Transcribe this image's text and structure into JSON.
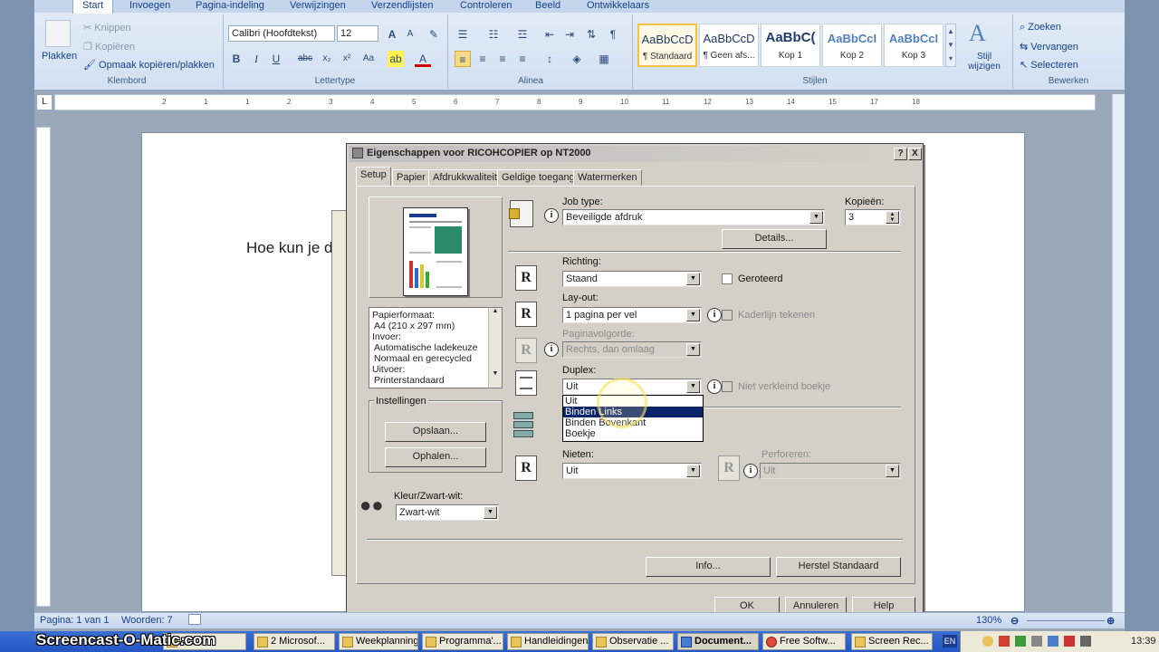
{
  "ribbon": {
    "tabs": [
      "Start",
      "Invoegen",
      "Pagina-indeling",
      "Verwijzingen",
      "Verzendlijsten",
      "Controleren",
      "Beeld",
      "Ontwikkelaars"
    ],
    "clipboard": {
      "paste": "Plakken",
      "cut": "Knippen",
      "copy": "Kopiëren",
      "format_painter": "Opmaak kopiëren/plakken",
      "label": "Klembord"
    },
    "font": {
      "name": "Calibri (Hoofdtekst)",
      "size": "12",
      "label": "Lettertype"
    },
    "paragraph": {
      "label": "Alinea"
    },
    "styles": {
      "items": [
        {
          "preview": "AaBbCcD",
          "name": "¶ Standaard"
        },
        {
          "preview": "AaBbCcD",
          "name": "¶ Geen afs..."
        },
        {
          "preview": "AaBbC(",
          "name": "Kop 1"
        },
        {
          "preview": "AaBbCcI",
          "name": "Kop 2"
        },
        {
          "preview": "AaBbCcI",
          "name": "Kop 3"
        }
      ],
      "change_styles": "Stijl wijzigen",
      "label": "Stijlen"
    },
    "editing": {
      "find": "Zoeken",
      "replace": "Vervangen",
      "select": "Selecteren",
      "label": "Bewerken"
    }
  },
  "ruler": {
    "marks": [
      "2",
      "1",
      "1",
      "2",
      "3",
      "4",
      "5",
      "6",
      "7",
      "8",
      "9",
      "10",
      "11",
      "12",
      "13",
      "14",
      "15",
      "17",
      "18"
    ]
  },
  "document": {
    "text": "Hoe kun je d"
  },
  "dialog": {
    "title": "Eigenschappen voor RICOHCOPIER op NT2000",
    "help_btn": "?",
    "close_btn": "X",
    "tabs": [
      "Setup",
      "Papier",
      "Afdrukkwaliteit",
      "Geldige toegang",
      "Watermerken"
    ],
    "paper_info": [
      "Papierformaat:",
      "A4 (210 x 297 mm)",
      "Invoer:",
      "Automatische ladekeuze",
      "Normaal en gerecycled",
      "Uitvoer:",
      "Printerstandaard"
    ],
    "settings_group": "Instellingen",
    "save_btn": "Opslaan...",
    "load_btn": "Ophalen...",
    "color_label": "Kleur/Zwart-wit:",
    "color_value": "Zwart-wit",
    "job_type_label": "Job type:",
    "job_type_value": "Beveiligde afdruk",
    "copies_label": "Kopieën:",
    "copies_value": "3",
    "details_btn": "Details...",
    "orientation_label": "Richting:",
    "orientation_value": "Staand",
    "rotated_label": "Geroteerd",
    "layout_label": "Lay-out:",
    "layout_value": "1 pagina per vel",
    "frame_label": "Kaderlijn tekenen",
    "page_order_label": "Paginavolgorde:",
    "page_order_value": "Rechts, dan omlaag",
    "duplex_label": "Duplex:",
    "duplex_value": "Uit",
    "booklet_label": "Niet verkleind boekje",
    "duplex_options": [
      "Uit",
      "Binden Links",
      "Binden Bovenkant",
      "Boekje"
    ],
    "staple_label": "Nieten:",
    "staple_value": "Uit",
    "punch_label": "Perforeren:",
    "punch_value": "Uit",
    "info_btn": "Info...",
    "restore_btn": "Herstel Standaard",
    "ok_btn": "OK",
    "cancel_btn": "Annuleren",
    "help_button": "Help"
  },
  "status": {
    "page": "Pagina: 1 van 1",
    "words": "Woorden: 7",
    "zoom": "130%"
  },
  "taskbar": {
    "watermark": "Screencast-O-Matic.com",
    "items": [
      "F...",
      "2 Microsof...",
      "Weekplanning",
      "Programma'...",
      "Handleidingen",
      "Observatie ...",
      "Document...",
      "Free Softw...",
      "Screen Rec..."
    ],
    "lang": "EN",
    "clock": "13:39"
  }
}
